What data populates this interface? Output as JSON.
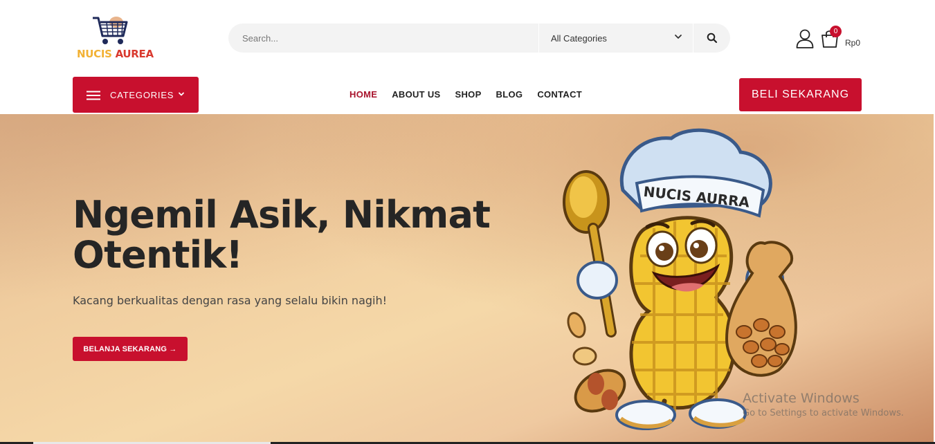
{
  "brand": {
    "word1": "NUCIS",
    "word2": "AUREA"
  },
  "search": {
    "placeholder": "Search...",
    "category": "All Categories"
  },
  "cart": {
    "count": "0",
    "total": "Rp0"
  },
  "categories_button": {
    "label": "CATEGORIES"
  },
  "nav": {
    "items": [
      {
        "label": "HOME"
      },
      {
        "label": "ABOUT US"
      },
      {
        "label": "SHOP"
      },
      {
        "label": "BLOG"
      },
      {
        "label": "CONTACT"
      }
    ],
    "active": "HOME"
  },
  "cta": {
    "label": "BELI SEKARANG"
  },
  "hero": {
    "title": "Ngemil Asik, Nikmat Otentik!",
    "subtitle": "Kacang berkualitas dengan rasa yang selalu bikin nagih!",
    "button": "BELANJA SEKARANG →",
    "mascot_hat_text": "NUCIS AURRA"
  },
  "watermark": {
    "line1": "Activate Windows",
    "line2": "Go to Settings to activate Windows."
  },
  "colors": {
    "primary": "#c8102e",
    "active_nav": "#a8122b",
    "logo_yellow": "#f2b134",
    "logo_red": "#d9392e"
  },
  "icons": [
    "cart-logo-icon",
    "chevron-down-icon",
    "search-icon",
    "user-icon",
    "shopping-bag-icon",
    "hamburger-menu-icon"
  ]
}
